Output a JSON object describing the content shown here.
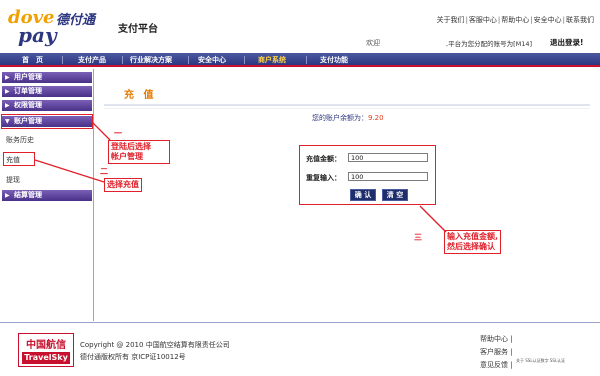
{
  "brand": {
    "logo_text_top": "dove",
    "logo_text_bottom": "pay",
    "logo_cn": "德付通",
    "platform": "支付平台"
  },
  "top_links": [
    "关于我们",
    "客服中心",
    "帮助中心",
    "安全中心",
    "联系我们"
  ],
  "user_bar": {
    "welcome": "欢迎",
    "account_text": ",平台为您分配的账号为[M14]",
    "logout": "退出登录!"
  },
  "nav": {
    "items": [
      {
        "label": "首　页"
      },
      {
        "label": "支付产品"
      },
      {
        "label": "行业解决方案"
      },
      {
        "label": "安全中心"
      },
      {
        "label": "商户系统"
      },
      {
        "label": "支付功能"
      }
    ]
  },
  "sidebar": {
    "sections": [
      "用户管理",
      "订单管理",
      "权限管理",
      "账户管理",
      "结算管理"
    ],
    "sub_items": [
      "账务历史",
      "充值",
      "提现"
    ]
  },
  "content": {
    "title": "充 值",
    "balance_label": "您的账户余额为：",
    "balance_value": "9.20",
    "form": {
      "amount_label": "充值金额：",
      "amount_value": "100",
      "repeat_label": "重复输入：",
      "repeat_value": "100",
      "confirm_button": "确 认",
      "clear_button": "清 空"
    }
  },
  "annotations": {
    "step1_num": "一",
    "step1_text_line1": "登陆后选择",
    "step1_text_line2": "帐户管理",
    "step2_num": "二",
    "step2_text": "选择充值",
    "step3_num": "三",
    "step3_text_line1": "输入充值金额,",
    "step3_text_line2": "然后选择确认"
  },
  "footer": {
    "logo_cn": "中国航信",
    "logo_en": "TravelSky",
    "copyright": "Copyright @ 2010 中国航空结算有限责任公司",
    "icp": "德付通版权所有  京ICP证10012号",
    "links": [
      "帮助中心",
      "客户服务",
      "意见反馈"
    ],
    "small_text": "关于 SSL认证数字 SSL认证"
  },
  "colors": {
    "nav_bg": "#2c3780",
    "accent_red": "#e0202a",
    "title_orange": "#e87a00"
  }
}
